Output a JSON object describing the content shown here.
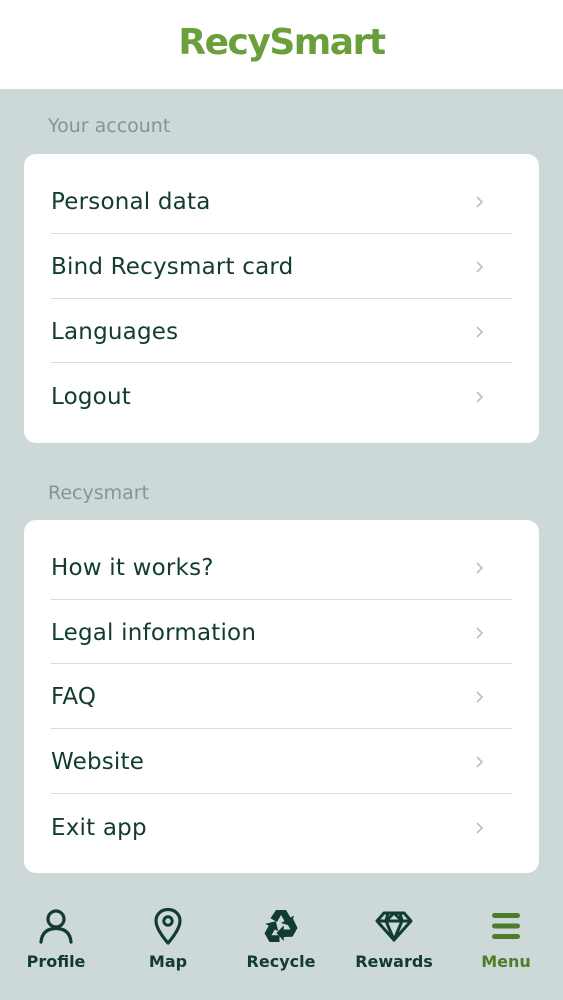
{
  "app": {
    "logo_text": "RecySmart",
    "brand_color": "#6a9f3c",
    "text_color": "#113b33",
    "background_color": "#cdd8d8"
  },
  "sections": [
    {
      "title": "Your account",
      "items": [
        {
          "label": "Personal data",
          "icon": "chevron-right-icon"
        },
        {
          "label": "Bind Recysmart card",
          "icon": "chevron-right-icon"
        },
        {
          "label": "Languages",
          "icon": "chevron-right-icon"
        },
        {
          "label": "Logout",
          "icon": "chevron-right-icon"
        }
      ]
    },
    {
      "title": "Recysmart",
      "items": [
        {
          "label": "How it works?",
          "icon": "chevron-right-icon"
        },
        {
          "label": "Legal information",
          "icon": "chevron-right-icon"
        },
        {
          "label": "FAQ",
          "icon": "chevron-right-icon"
        },
        {
          "label": "Website",
          "icon": "chevron-right-icon"
        },
        {
          "label": "Exit app",
          "icon": "chevron-right-icon"
        }
      ]
    }
  ],
  "bottom_nav": [
    {
      "label": "Profile",
      "icon": "person-icon",
      "active": false
    },
    {
      "label": "Map",
      "icon": "map-pin-icon",
      "active": false
    },
    {
      "label": "Recycle",
      "icon": "recycle-icon",
      "active": false
    },
    {
      "label": "Rewards",
      "icon": "diamond-icon",
      "active": false
    },
    {
      "label": "Menu",
      "icon": "menu-icon",
      "active": true
    }
  ]
}
